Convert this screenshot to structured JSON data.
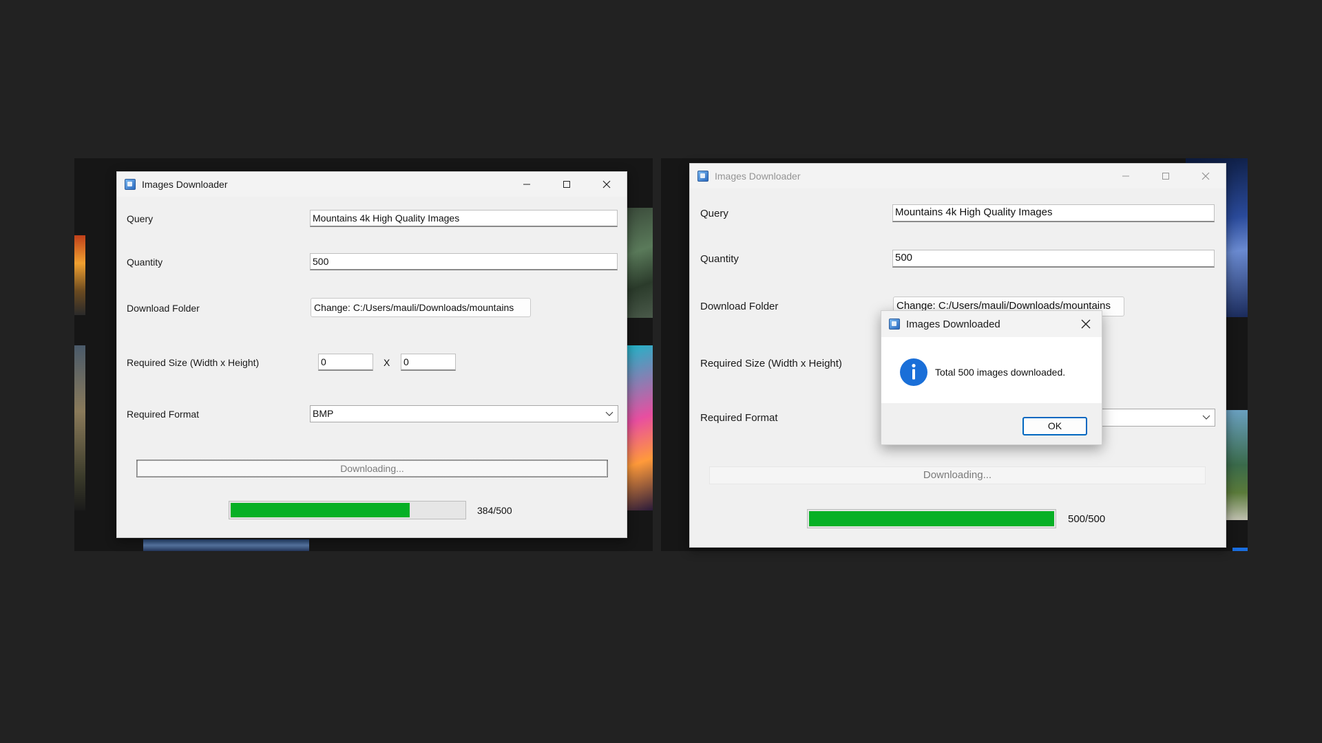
{
  "left_window": {
    "title": "Images Downloader",
    "query_label": "Query",
    "query_value": "Mountains 4k High Quality Images",
    "quantity_label": "Quantity",
    "quantity_value": "500",
    "folder_label": "Download Folder",
    "folder_button": "Change: C:/Users/mauli/Downloads/mountains",
    "size_label": "Required Size (Width x Height)",
    "width_value": "0",
    "size_separator": "X",
    "height_value": "0",
    "format_label": "Required Format",
    "format_value": "BMP",
    "download_button": "Downloading...",
    "progress_text": "384/500",
    "progress_fraction": 0.768
  },
  "right_window": {
    "title": "Images Downloader",
    "query_label": "Query",
    "query_value": "Mountains 4k High Quality Images",
    "quantity_label": "Quantity",
    "quantity_value": "500",
    "folder_label": "Download Folder",
    "folder_button": "Change: C:/Users/mauli/Downloads/mountains",
    "size_label": "Required Size (Width x Height)",
    "format_label": "Required Format",
    "download_button": "Downloading...",
    "progress_text": "500/500",
    "progress_fraction": 1.0
  },
  "dialog": {
    "title": "Images Downloaded",
    "message": "Total 500 images downloaded.",
    "ok_label": "OK",
    "icon": "info-icon"
  },
  "colors": {
    "background": "#222222",
    "progress_fill": "#06b025",
    "accent": "#0067c0"
  }
}
